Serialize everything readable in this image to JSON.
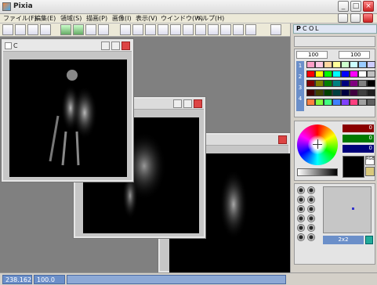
{
  "app": {
    "title": "Pixia"
  },
  "menu": [
    {
      "label": "ファイル(F)"
    },
    {
      "label": "編集(E)"
    },
    {
      "label": "領域(S)"
    },
    {
      "label": "描画(P)"
    },
    {
      "label": "画像(I)"
    },
    {
      "label": "表示(V)"
    },
    {
      "label": "ウインドウ(W)"
    },
    {
      "label": "ヘルプ(H)"
    }
  ],
  "doc_window": {
    "title": "C"
  },
  "panel": {
    "mode_labels": [
      "P",
      "C",
      "O",
      "L"
    ],
    "opacity_left": "100",
    "opacity_right": "100",
    "layer_numbers": [
      "1",
      "2",
      "3",
      "4"
    ],
    "rgb_values": [
      "0",
      "0",
      "0"
    ],
    "rgb_label": "RGB",
    "mini_label": "2x2"
  },
  "status": {
    "coords": "238.162",
    "zoom": "100.0"
  },
  "colors": {
    "accent": "#6b8fc9",
    "workspace": "#808080"
  }
}
